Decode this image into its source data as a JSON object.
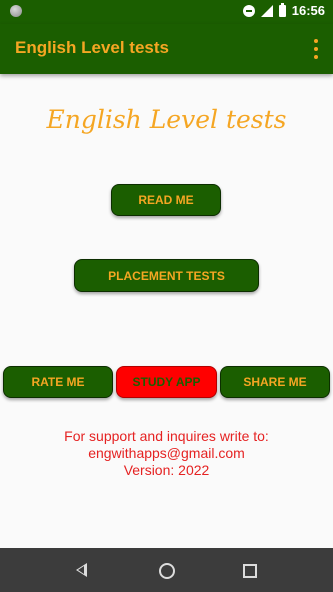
{
  "status_bar": {
    "time": "16:56"
  },
  "app_bar": {
    "title": "English Level tests",
    "menu_icon": "overflow-menu-icon"
  },
  "main": {
    "logo_text": "English Level tests",
    "read_me_label": "READ ME",
    "placement_tests_label": "PLACEMENT TESTS",
    "rate_me_label": "RATE ME",
    "study_app_label": "STUDY APP",
    "share_me_label": "SHARE ME"
  },
  "support": {
    "line1": "For support and inquires write to:",
    "email": "engwithapps@gmail.com",
    "version": "Version: 2022"
  },
  "colors": {
    "primary": "#1b5e00",
    "accent": "#f5a623",
    "danger": "#ff0000",
    "support_text": "#e52222"
  },
  "nav_bar": {
    "icons": [
      "back-icon",
      "home-icon",
      "recents-icon"
    ]
  }
}
